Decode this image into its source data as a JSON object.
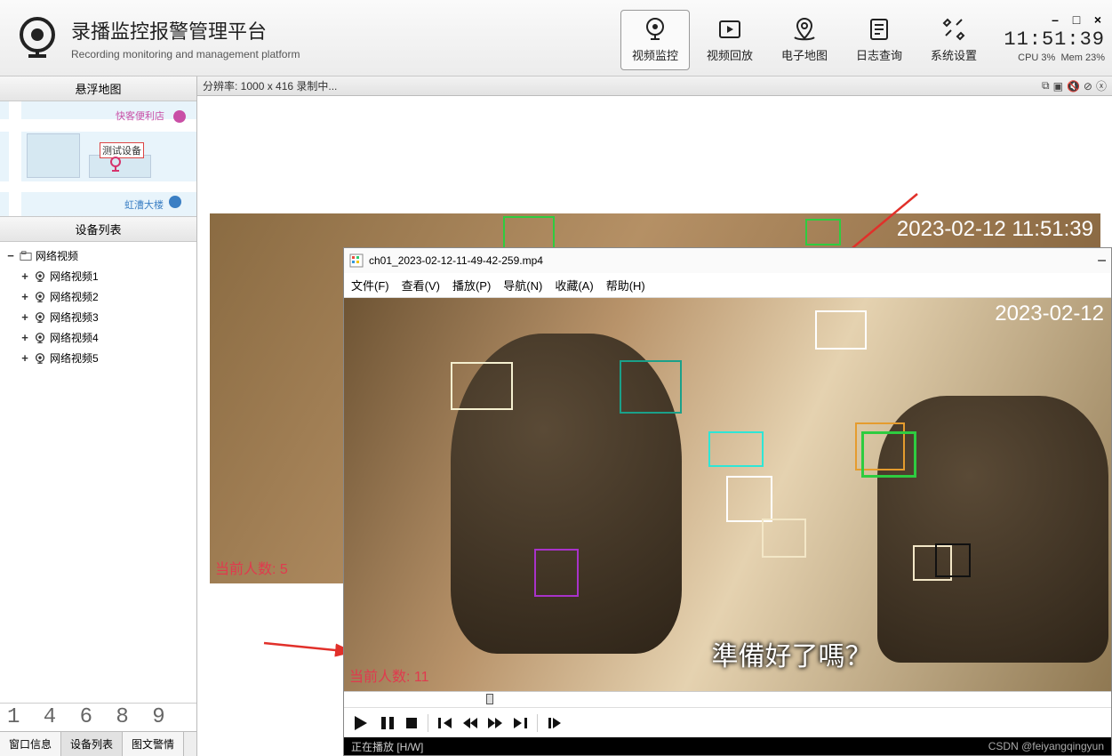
{
  "header": {
    "title": "录播监控报警管理平台",
    "subtitle": "Recording monitoring and management platform",
    "clock": "11:51:39",
    "cpu": "CPU 3%",
    "mem": "Mem 23%"
  },
  "nav": [
    {
      "label": "视频监控",
      "active": true
    },
    {
      "label": "视频回放",
      "active": false
    },
    {
      "label": "电子地图",
      "active": false
    },
    {
      "label": "日志查询",
      "active": false
    },
    {
      "label": "系统设置",
      "active": false
    }
  ],
  "sidebar": {
    "map_title": "悬浮地图",
    "device_title": "设备列表",
    "map_marker": "测试设备",
    "map_poi1": "快客便利店",
    "map_poi2": "虹漕大楼",
    "tree_root": "网络视频",
    "tree_items": [
      "网络视频1",
      "网络视频2",
      "网络视频3",
      "网络视频4",
      "网络视频5"
    ],
    "tabs": [
      "窗口信息",
      "设备列表",
      "图文警情"
    ],
    "active_tab": 1,
    "counter": "1 4 6 8 9"
  },
  "statusbar": {
    "text": "分辨率: 1000 x 416 录制中..."
  },
  "back_video": {
    "timestamp": "2023-02-12 11:51:39",
    "people_label": "当前人数: 5"
  },
  "player": {
    "filename": "ch01_2023-02-12-11-49-42-259.mp4",
    "menu": [
      "文件(F)",
      "查看(V)",
      "播放(P)",
      "导航(N)",
      "收藏(A)",
      "帮助(H)"
    ],
    "timestamp": "2023-02-12",
    "people_label": "当前人数: 11",
    "subtitle": "準備好了嗎？",
    "status": "正在播放 [H/W]",
    "watermark": "CSDN @feiyangqingyun"
  }
}
